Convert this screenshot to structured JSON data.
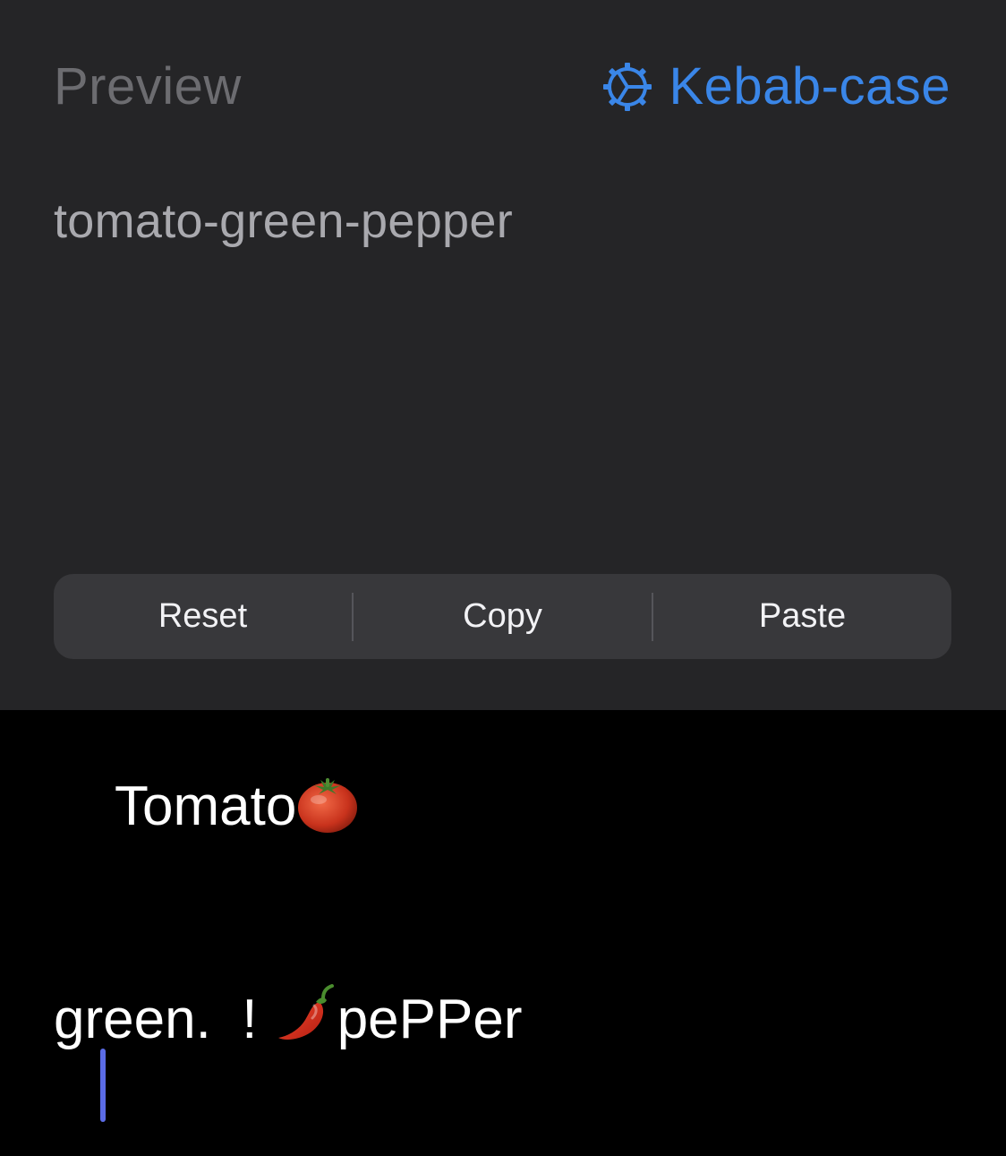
{
  "header": {
    "title": "Preview",
    "mode_label": "Kebab-case",
    "mode_icon": "gear-icon",
    "accent_color": "#3a86e8"
  },
  "preview": {
    "output_text": "tomato-green-pepper"
  },
  "actions": {
    "reset_label": "Reset",
    "copy_label": "Copy",
    "paste_label": "Paste"
  },
  "editor": {
    "line1_text": "Tomato",
    "line2_text_a": "green.  ! ",
    "line2_text_b": "pePPer",
    "tomato_emoji": "tomato-emoji",
    "pepper_emoji": "hot-pepper-emoji"
  }
}
